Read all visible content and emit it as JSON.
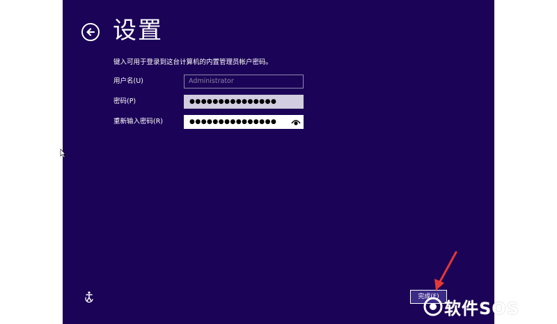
{
  "header": {
    "title": "设置"
  },
  "instruction": "键入可用于登录到这台计算机的内置管理员帐户密码。",
  "form": {
    "username": {
      "label": "用户名(U)",
      "placeholder": "Administrator"
    },
    "password": {
      "label": "密码(P)",
      "masked_value": "●●●●●●●●●●●●●●●"
    },
    "reenter_password": {
      "label": "重新输入密码(R)",
      "masked_value": "●●●●●●●●●●●●●●●"
    }
  },
  "footer": {
    "finish_button": "完成(F)"
  },
  "watermark": {
    "text": "软件SOS"
  },
  "colors": {
    "background": "#1b0357",
    "page": "#ffffff",
    "accent_arrow": "#e53935"
  },
  "icons": [
    "back-arrow-icon",
    "reveal-password-icon",
    "ease-of-access-icon",
    "mouse-cursor-icon"
  ]
}
